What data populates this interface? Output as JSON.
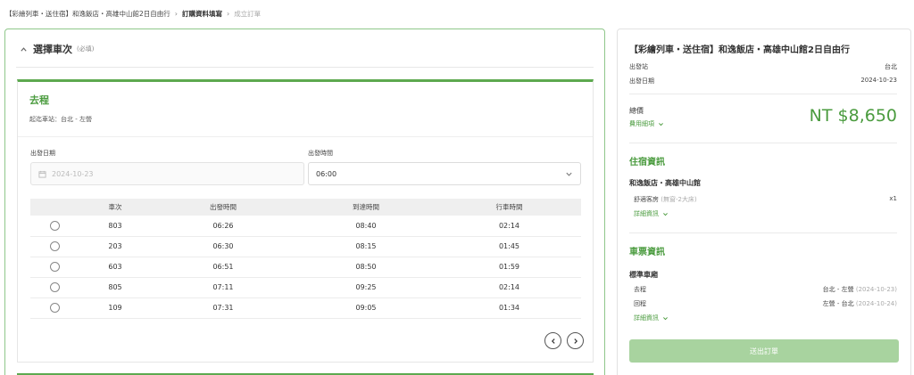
{
  "breadcrumb": {
    "item1": "【彩繪列車・送住宿】和逸飯店・高雄中山館2日自由行",
    "item2": "訂購資料填寫",
    "item3": "成立訂單"
  },
  "train_section": {
    "title": "選擇車次",
    "required": "(必填)"
  },
  "trip": {
    "title": "去程",
    "route": "起迄車站：台北 - 左營",
    "date_label": "出發日期",
    "date_value": "2024-10-23",
    "time_label": "出發時間",
    "time_value": "06:00",
    "columns": [
      "車次",
      "出發時間",
      "到達時間",
      "行車時間"
    ],
    "rows": [
      [
        "803",
        "06:26",
        "08:40",
        "02:14"
      ],
      [
        "203",
        "06:30",
        "08:15",
        "01:45"
      ],
      [
        "603",
        "06:51",
        "08:50",
        "01:59"
      ],
      [
        "805",
        "07:11",
        "09:25",
        "02:14"
      ],
      [
        "109",
        "07:31",
        "09:05",
        "01:34"
      ]
    ]
  },
  "summary": {
    "title": "【彩繪列車・送住宿】和逸飯店・高雄中山館2日自由行",
    "station_label": "出發站",
    "station_value": "台北",
    "date_label": "出發日期",
    "date_value": "2024-10-23",
    "total_label": "總價",
    "fee_link": "費用細項",
    "price": "NT $8,650",
    "hotel_heading": "住宿資訊",
    "hotel_name": "和逸飯店・高雄中山館",
    "room_name": "舒適客房",
    "room_note": "(無窗-2大床)",
    "room_qty": "x1",
    "hotel_detail": "詳細資訊",
    "ticket_heading": "車票資訊",
    "car_type": "標準車廂",
    "go_label": "去程",
    "go_route": "台北 - 左營",
    "go_date": "(2024-10-23)",
    "back_label": "回程",
    "back_route": "左營 - 台北",
    "back_date": "(2024-10-24)",
    "ticket_detail": "詳細資訊",
    "submit": "送出訂單"
  },
  "colors": {
    "accent_green": "#4a9b3e",
    "button_green": "#a8d39f"
  },
  "icons": [
    "chevron-up-icon",
    "calendar-icon",
    "chevron-down-icon",
    "chevron-left-icon",
    "chevron-right-icon"
  ]
}
